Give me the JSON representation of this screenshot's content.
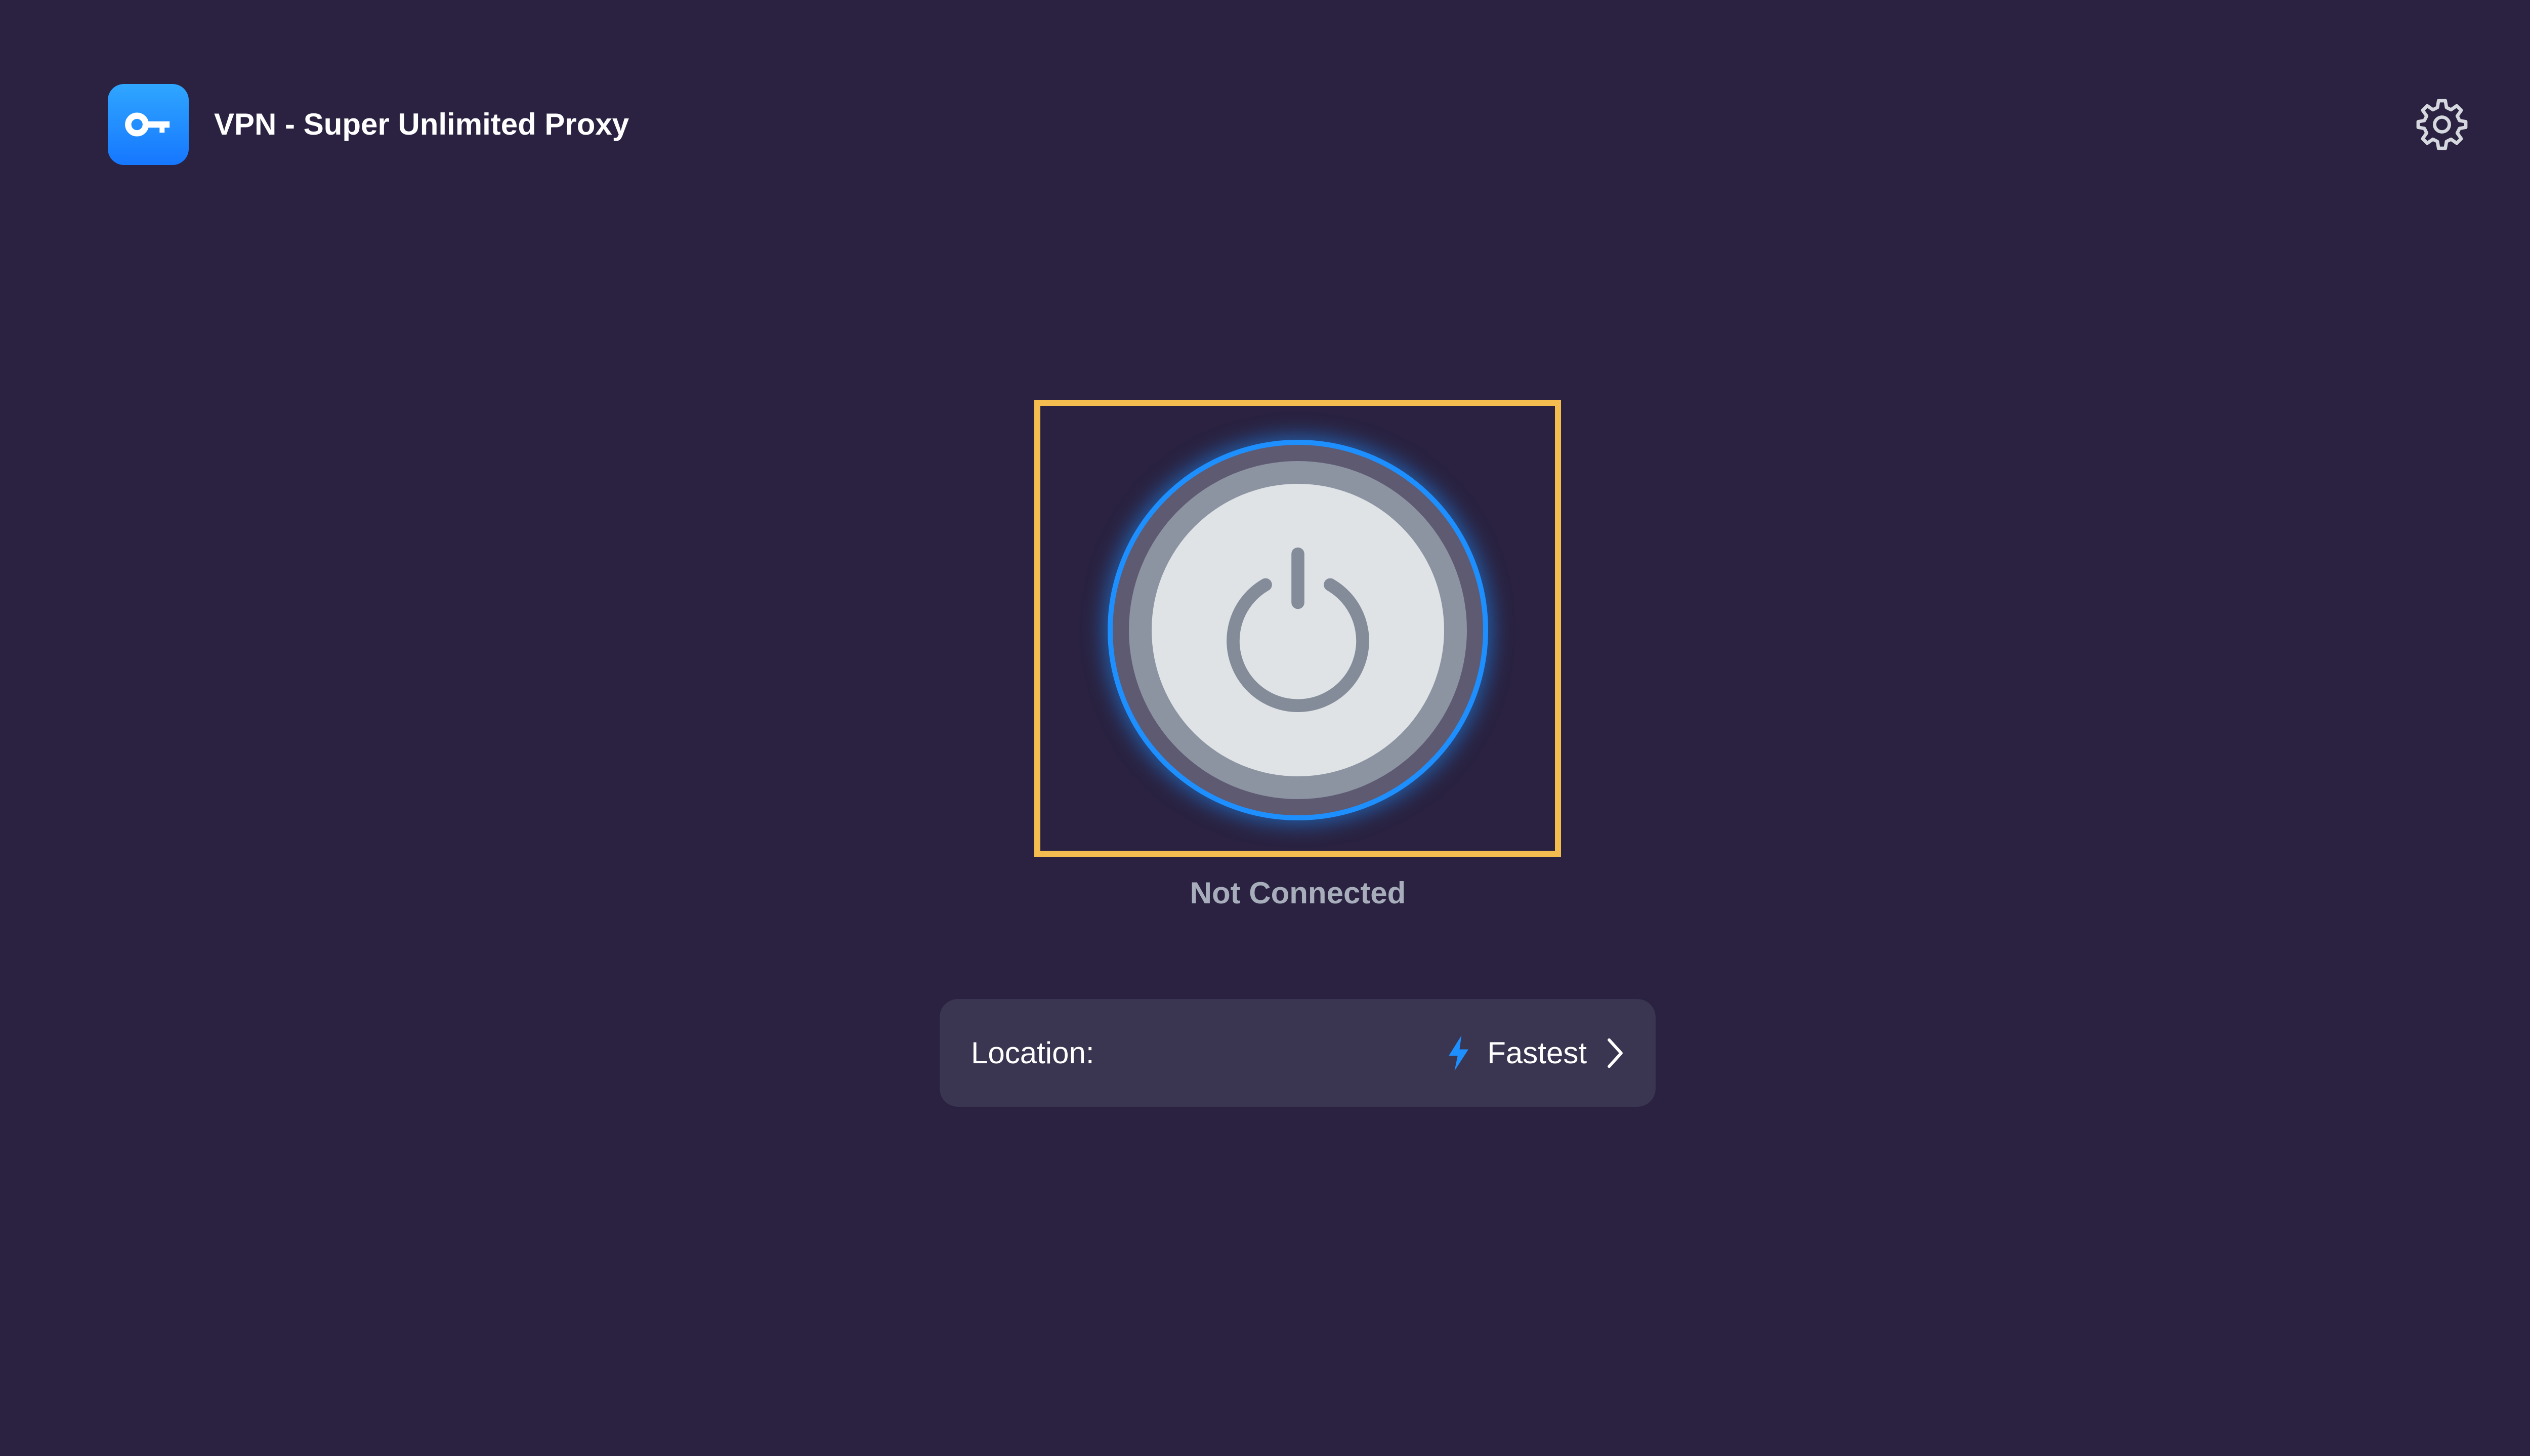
{
  "app": {
    "title": "VPN - Super Unlimited Proxy",
    "icon": "key-icon",
    "icon_color": "#1e8fff"
  },
  "header": {
    "settings_icon": "gear-icon"
  },
  "connection": {
    "status": "Not Connected",
    "power_icon": "power-icon",
    "ring_color": "#1e8fff",
    "focus_color": "#f5bd4f"
  },
  "location": {
    "label": "Location:",
    "value": "Fastest",
    "value_icon": "lightning-bolt-icon",
    "chevron_icon": "chevron-right-icon",
    "accent_color": "#1e8fff"
  },
  "theme": {
    "background": "#2a2240",
    "card": "#3a3550"
  }
}
